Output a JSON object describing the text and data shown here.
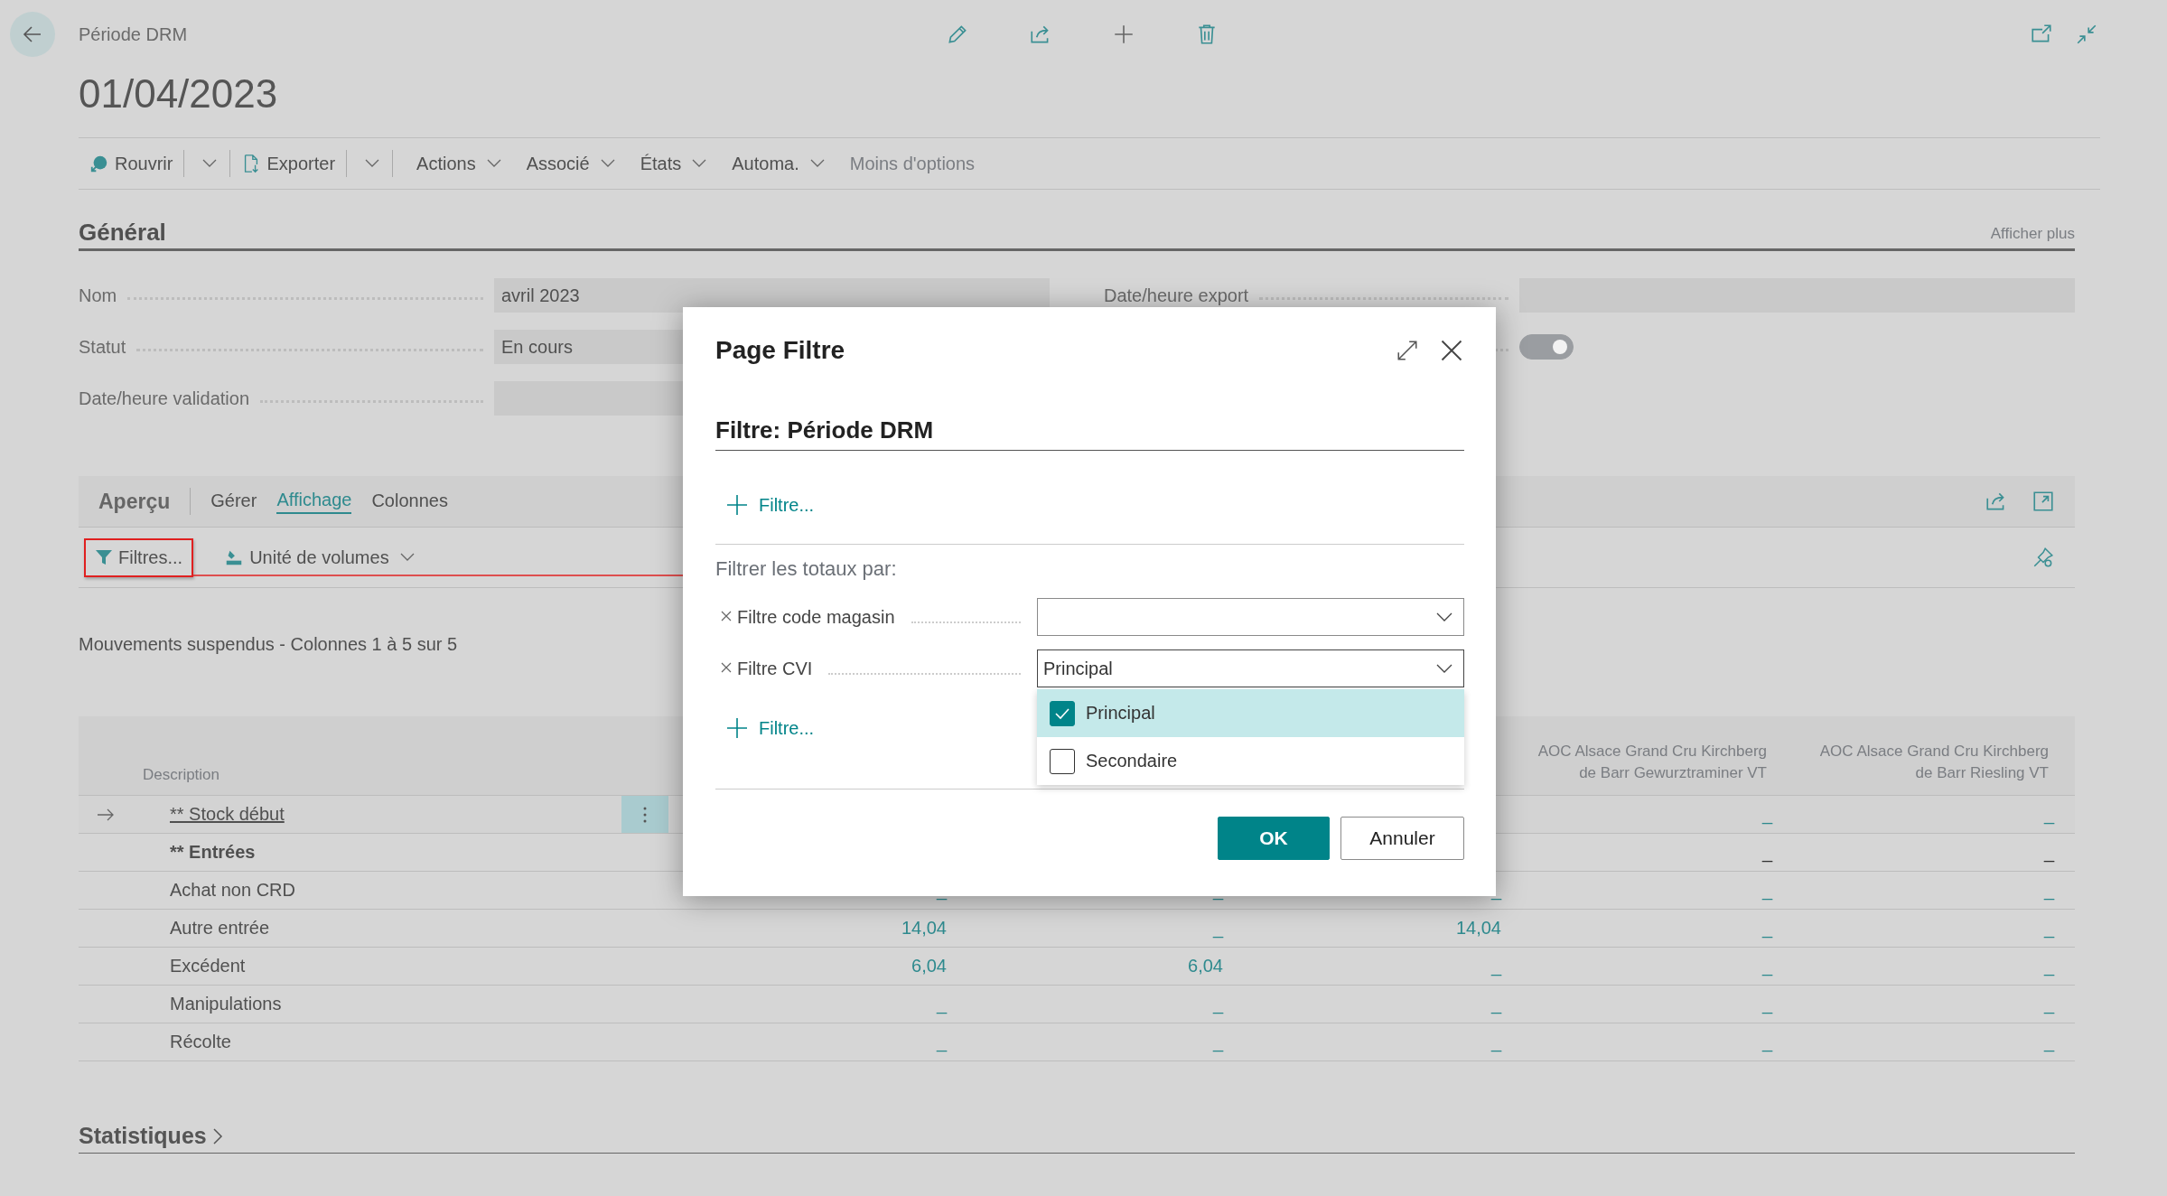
{
  "header": {
    "breadcrumb": "Période DRM",
    "title": "01/04/2023"
  },
  "action_bar": [
    {
      "label": "Rouvrir",
      "kind": "split"
    },
    {
      "label": "Exporter",
      "kind": "split"
    },
    {
      "label": "Actions",
      "kind": "menu"
    },
    {
      "label": "Associé",
      "kind": "menu"
    },
    {
      "label": "États",
      "kind": "menu"
    },
    {
      "label": "Automa.",
      "kind": "menu"
    },
    {
      "label": "Moins d'options",
      "kind": "link"
    }
  ],
  "general": {
    "title": "Général",
    "more": "Afficher plus",
    "left_fields": [
      {
        "label": "Nom",
        "value": "avril 2023"
      },
      {
        "label": "Statut",
        "value": "En cours"
      },
      {
        "label": "Date/heure validation"
      }
    ],
    "right_fields": [
      {
        "label": "Date/heure export",
        "kind": "text"
      },
      {
        "kind": "toggle",
        "on": true
      }
    ]
  },
  "part": {
    "title": "Aperçu",
    "tabs": [
      {
        "label": "Gérer",
        "selected": false
      },
      {
        "label": "Affichage",
        "selected": true
      },
      {
        "label": "Colonnes",
        "selected": false
      }
    ],
    "tools": [
      {
        "label": "Filtres...",
        "kind": "filter",
        "annotated": true
      },
      {
        "label": "Unité de volumes",
        "kind": "dropdown",
        "annotated": false
      }
    ]
  },
  "table": {
    "caption": "Mouvements suspendus - Colonnes 1 à 5 sur 5",
    "columns": [
      "Description",
      null,
      null,
      null,
      "AOC Alsace Grand Cru Kirchberg de Barr Gewurztraminer VT",
      "AOC Alsace Grand Cru Kirchberg de Barr Riesling VT"
    ],
    "rows": [
      {
        "description": "** Stock début",
        "kind": "link",
        "current": true,
        "values": [
          "_",
          "_"
        ]
      },
      {
        "description": "** Entrées",
        "kind": "bold",
        "current": false,
        "values": [
          "_",
          "_"
        ]
      },
      {
        "description": "Achat non CRD",
        "kind": "plain",
        "current": false,
        "values": [
          "_",
          "_",
          "_",
          "_",
          "_"
        ]
      },
      {
        "description": "Autre entrée",
        "kind": "plain",
        "current": false,
        "values": [
          "14,04",
          "_",
          "14,04",
          "_",
          "_"
        ]
      },
      {
        "description": "Excédent",
        "kind": "plain",
        "current": false,
        "values": [
          "6,04",
          "6,04",
          "_",
          "_",
          "_"
        ]
      },
      {
        "description": "Manipulations",
        "kind": "plain",
        "current": false,
        "values": [
          "_",
          "_",
          "_",
          "_",
          "_"
        ]
      },
      {
        "description": "Récolte",
        "kind": "plain",
        "current": false,
        "values": [
          "_",
          "_",
          "_",
          "_",
          "_"
        ]
      }
    ]
  },
  "statistics": {
    "title": "Statistiques"
  },
  "dialog": {
    "title": "Page Filtre",
    "subtitle": "Filtre: Période DRM",
    "add_filters": [
      "Filtre...",
      "Filtre..."
    ],
    "totals_heading": "Filtrer les totaux par:",
    "filters": [
      {
        "label": "Filtre code magasin",
        "expanded": false
      },
      {
        "label": "Filtre CVI",
        "value": "Principal",
        "expanded": true,
        "options": [
          {
            "label": "Principal",
            "checked": true,
            "selected": true
          },
          {
            "label": "Secondaire",
            "checked": false,
            "selected": false
          }
        ]
      }
    ],
    "buttons": [
      {
        "label": "OK",
        "kind": "primary"
      },
      {
        "label": "Annuler",
        "kind": "secondary"
      }
    ]
  }
}
